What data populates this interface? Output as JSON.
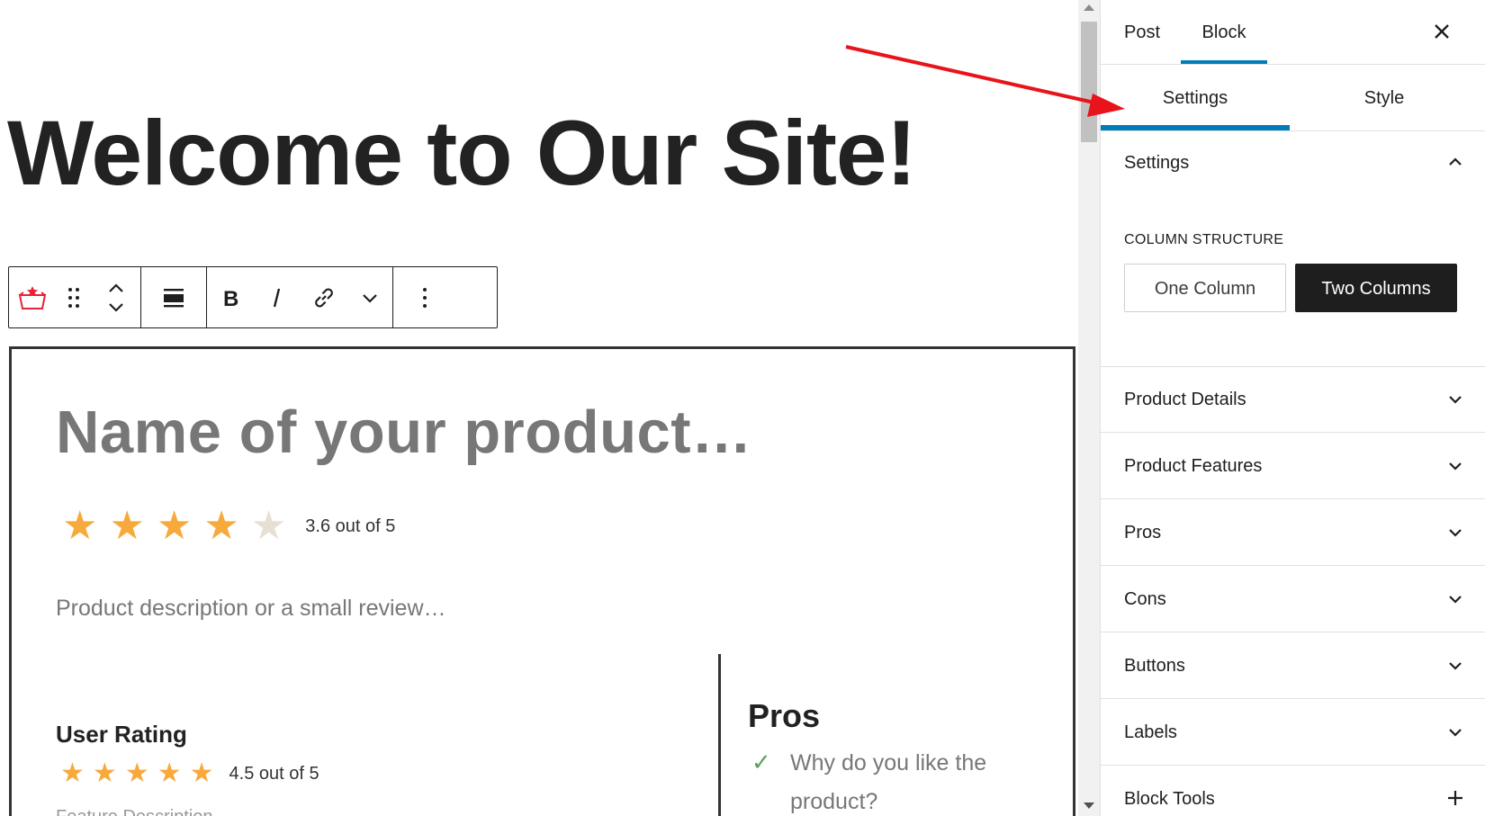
{
  "editor": {
    "page_title": "Welcome to Our Site!",
    "product": {
      "name_placeholder": "Name of your product…",
      "rating": 3.6,
      "rating_max": 5,
      "rating_text": "3.6 out of 5",
      "description_placeholder": "Product description or a small review…",
      "user_rating_title": "User Rating",
      "user_rating": 4.5,
      "user_rating_text": "4.5 out of 5",
      "feature_description": "Feature Description",
      "pros_title": "Pros",
      "pros_item": "Why do you like the product?"
    },
    "toolbar": {
      "items": [
        "block-type-icon",
        "drag-handle-icon",
        "move-up-down-icon",
        "align-icon",
        "bold-icon",
        "italic-icon",
        "link-icon",
        "more-formats-chevron-icon",
        "options-kebab-icon"
      ]
    }
  },
  "sidebar": {
    "tabs": {
      "post": "Post",
      "block": "Block",
      "active": "Block"
    },
    "subtabs": {
      "settings": "Settings",
      "style": "Style",
      "active": "Settings"
    },
    "settings_panel": {
      "title": "Settings",
      "column_structure_label": "COLUMN STRUCTURE",
      "one_column": "One Column",
      "two_columns": "Two Columns",
      "selected": "Two Columns"
    },
    "panels": [
      {
        "title": "Product Details",
        "icon": "chevron-down-icon"
      },
      {
        "title": "Product Features",
        "icon": "chevron-down-icon"
      },
      {
        "title": "Pros",
        "icon": "chevron-down-icon"
      },
      {
        "title": "Cons",
        "icon": "chevron-down-icon"
      },
      {
        "title": "Buttons",
        "icon": "chevron-down-icon"
      },
      {
        "title": "Labels",
        "icon": "chevron-down-icon"
      },
      {
        "title": "Block Tools",
        "icon": "plus-icon"
      }
    ]
  },
  "colors": {
    "accent": "#007cba",
    "star": "#f7a93c",
    "star_empty": "#e6e0d4",
    "arrow": "#e8141b",
    "dark_button": "#1e1e1e"
  }
}
